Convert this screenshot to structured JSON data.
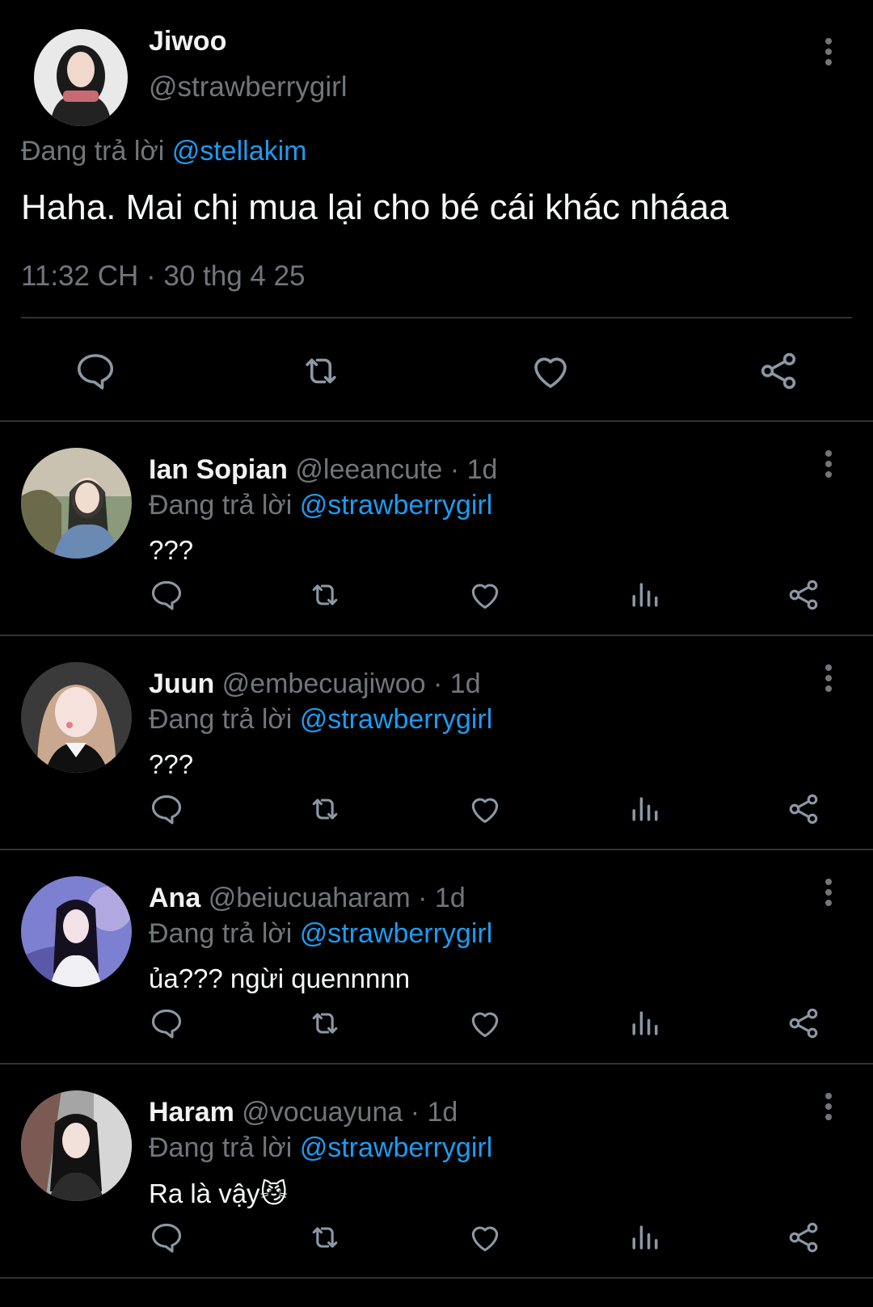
{
  "main_tweet": {
    "name": "Jiwoo",
    "handle": "@strawberrygirl",
    "replying_prefix": "Đang trả lời",
    "replying_to": "@stellakim",
    "text": "Haha. Mai chị mua lại cho bé cái khác nháaa",
    "timestamp": "11:32 CH · 30 thg 4 25",
    "actions": [
      "reply-icon",
      "retweet-icon",
      "like-icon",
      "share-icon"
    ]
  },
  "replies": [
    {
      "name": "Ian Sopian",
      "handle": "@leeancute",
      "separator": "·",
      "age": "1d",
      "replying_prefix": "Đang trả lời",
      "replying_to": "@strawberrygirl",
      "text": "???"
    },
    {
      "name": "Juun",
      "handle": "@embecuajiwoo",
      "separator": "·",
      "age": "1d",
      "replying_prefix": "Đang trả lời",
      "replying_to": "@strawberrygirl",
      "text": "???"
    },
    {
      "name": "Ana",
      "handle": "@beiucuaharam",
      "separator": "·",
      "age": "1d",
      "replying_prefix": "Đang trả lời",
      "replying_to": "@strawberrygirl",
      "text": "ủa??? ngừi quennnnn"
    },
    {
      "name": "Haram",
      "handle": "@vocuayuna",
      "separator": "·",
      "age": "1d",
      "replying_prefix": "Đang trả lời",
      "replying_to": "@strawberrygirl",
      "text": "Ra là vậy😼"
    }
  ],
  "colors": {
    "background": "#000000",
    "text": "#e7e9ea",
    "muted": "#71767b",
    "mention": "#1d9bf0",
    "divider": "#2f3336"
  }
}
